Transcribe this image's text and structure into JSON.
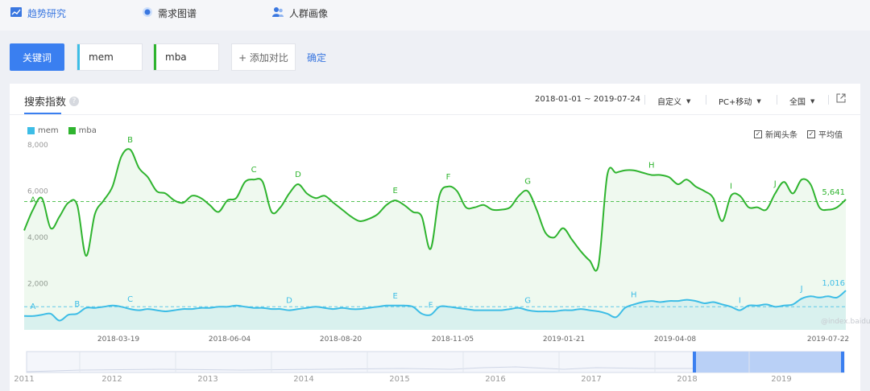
{
  "tabs": [
    {
      "label": "趋势研究",
      "icon": "chart-icon",
      "active": true
    },
    {
      "label": "需求图谱",
      "icon": "radar-icon",
      "active": false
    },
    {
      "label": "人群画像",
      "icon": "people-icon",
      "active": false
    }
  ],
  "toolbar": {
    "keyword_button": "关键词",
    "keywords": [
      {
        "value": "mem",
        "color": "#3dbde6"
      },
      {
        "value": "mba",
        "color": "#2fb42f"
      }
    ],
    "add_compare": "+ 添加对比",
    "confirm": "确定"
  },
  "panel": {
    "title": "搜索指数",
    "date_range": "2018-01-01 ~ 2019-07-24",
    "custom": "自定义",
    "device": "PC+移动",
    "region": "全国",
    "news_checkbox": "新闻头条",
    "avg_checkbox": "平均值",
    "watermark": "@index.baidu.com"
  },
  "colors": {
    "accent": "#3a7ff0",
    "mem": "#3dbde6",
    "mba": "#2fb42f"
  },
  "chart_data": {
    "type": "line",
    "x_tick_labels": [
      "2018-03-19",
      "2018-06-04",
      "2018-08-20",
      "2018-11-05",
      "2019-01-21",
      "2019-04-08",
      "2019-07-22"
    ],
    "y_tick_labels": [
      "2,000",
      "4,000",
      "6,000",
      "8,000"
    ],
    "ylim": [
      0,
      8700
    ],
    "series": [
      {
        "name": "mba",
        "color": "#2fb42f",
        "last_label": "5,641",
        "average": 5550,
        "values": [
          4300,
          5200,
          5700,
          4400,
          4900,
          5500,
          5400,
          3200,
          5000,
          5600,
          6200,
          7500,
          7800,
          7000,
          6600,
          6000,
          5900,
          5600,
          5500,
          5800,
          5700,
          5400,
          5100,
          5600,
          5700,
          6400,
          6500,
          6400,
          5100,
          5300,
          5900,
          6300,
          5900,
          5700,
          5800,
          5500,
          5200,
          4900,
          4700,
          4800,
          5000,
          5400,
          5600,
          5400,
          5100,
          4900,
          3500,
          5800,
          6200,
          6000,
          5300,
          5300,
          5400,
          5200,
          5200,
          5300,
          5800,
          6000,
          5200,
          4200,
          4000,
          4400,
          3900,
          3400,
          3000,
          2800,
          6700,
          6800,
          6900,
          6900,
          6800,
          6700,
          6700,
          6600,
          6300,
          6500,
          6200,
          6000,
          5700,
          4700,
          5800,
          5800,
          5300,
          5300,
          5200,
          5900,
          6400,
          5900,
          6500,
          6300,
          5300,
          5200,
          5300,
          5641
        ],
        "annotations": [
          {
            "letter": "A",
            "index": 1
          },
          {
            "letter": "B",
            "index": 12
          },
          {
            "letter": "C",
            "index": 26
          },
          {
            "letter": "D",
            "index": 31
          },
          {
            "letter": "E",
            "index": 42
          },
          {
            "letter": "F",
            "index": 48
          },
          {
            "letter": "G",
            "index": 57
          },
          {
            "letter": "H",
            "index": 71
          },
          {
            "letter": "I",
            "index": 80
          },
          {
            "letter": "J",
            "index": 85
          }
        ]
      },
      {
        "name": "mem",
        "color": "#3dbde6",
        "last_label": "1,016",
        "average": 1000,
        "values": [
          600,
          600,
          650,
          700,
          400,
          650,
          700,
          950,
          950,
          1000,
          1050,
          1000,
          900,
          850,
          900,
          850,
          800,
          850,
          900,
          900,
          950,
          950,
          1000,
          1000,
          1050,
          1000,
          950,
          950,
          900,
          900,
          850,
          900,
          950,
          1000,
          950,
          900,
          950,
          900,
          900,
          950,
          1000,
          1050,
          1050,
          1050,
          1000,
          700,
          650,
          1000,
          1000,
          950,
          900,
          850,
          850,
          850,
          850,
          900,
          950,
          850,
          800,
          800,
          800,
          850,
          850,
          900,
          850,
          800,
          700,
          550,
          950,
          1100,
          1200,
          1250,
          1200,
          1250,
          1250,
          1300,
          1250,
          1150,
          1200,
          1100,
          1000,
          850,
          1050,
          1050,
          1100,
          1000,
          1050,
          1100,
          1350,
          1450,
          1400,
          1450,
          1400,
          1700
        ],
        "annotations": [
          {
            "letter": "A",
            "index": 1
          },
          {
            "letter": "B",
            "index": 6
          },
          {
            "letter": "C",
            "index": 12
          },
          {
            "letter": "D",
            "index": 30
          },
          {
            "letter": "E",
            "index": 42
          },
          {
            "letter": "F",
            "index": 46
          },
          {
            "letter": "G",
            "index": 57
          },
          {
            "letter": "H",
            "index": 69
          },
          {
            "letter": "I",
            "index": 81
          },
          {
            "letter": "J",
            "index": 88
          }
        ]
      }
    ],
    "grid": false,
    "legend": "top-left"
  },
  "timeline": {
    "years": [
      "2011",
      "2012",
      "2013",
      "2014",
      "2015",
      "2016",
      "2017",
      "2018",
      "2019"
    ]
  }
}
